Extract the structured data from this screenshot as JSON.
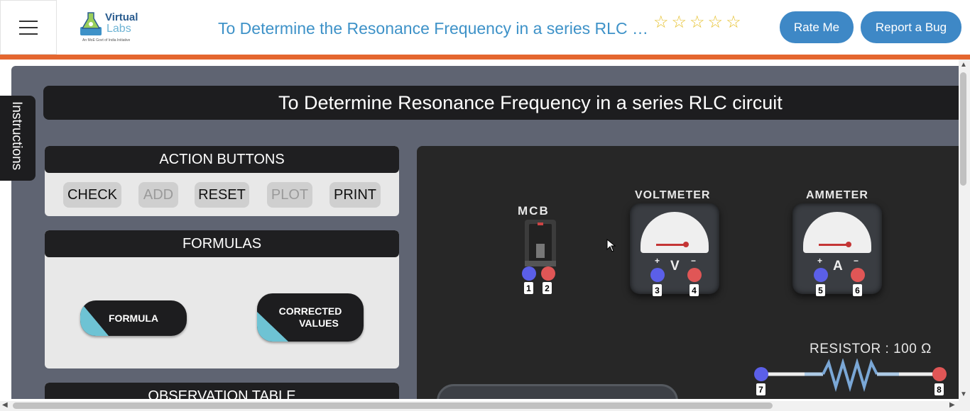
{
  "header": {
    "logo_line1": "Virtual",
    "logo_line2": "Labs",
    "logo_tagline": "An MoE Govt of India Initiative",
    "page_title": "To Determine the Resonance Frequency in a series RLC circuit",
    "star_glyph": "☆",
    "rate_button": "Rate Me",
    "bug_button": "Report a Bug"
  },
  "colors": {
    "accent": "#3e88c6",
    "orange_bar": "#e4662f",
    "panel_head": "#1f1f21",
    "formula_accent": "#6ec3d4"
  },
  "sim": {
    "title": "To Determine Resonance Frequency in a series RLC circuit",
    "instructions_tab": "Instructions"
  },
  "actions": {
    "heading": "ACTION BUTTONS",
    "check": "CHECK",
    "add": "ADD",
    "reset": "RESET",
    "plot": "PLOT",
    "print": "PRINT"
  },
  "formulas": {
    "heading": "FORMULAS",
    "formula": "FORMULA",
    "corrected_line1": "CORRECTED",
    "corrected_line2": "VALUES"
  },
  "observation": {
    "heading": "OBSERVATION TABLE"
  },
  "board": {
    "mcb_label": "MCB",
    "voltmeter_label": "VOLTMETER",
    "voltmeter_letter": "V",
    "ammeter_label": "AMMETER",
    "ammeter_letter": "A",
    "resistor_label": "RESISTOR : 100 Ω",
    "terminals": [
      "1",
      "2",
      "3",
      "4",
      "5",
      "6",
      "7",
      "8"
    ],
    "plus": "+",
    "minus": "−"
  }
}
